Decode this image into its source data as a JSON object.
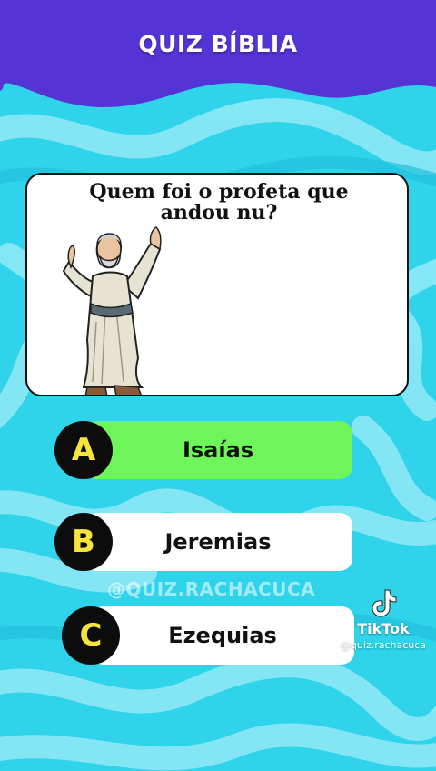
{
  "header": {
    "title": "QUIZ BÍBLIA"
  },
  "question": {
    "text": "Quem foi o profeta que andou nu?"
  },
  "answers": [
    {
      "letter": "A",
      "text": "Isaías"
    },
    {
      "letter": "B",
      "text": "Jeremias"
    },
    {
      "letter": "C",
      "text": "Ezequias"
    }
  ],
  "watermark": {
    "text": "@QUIZ.RACHACUCA"
  },
  "tiktok": {
    "icon": "tiktok-note-icon",
    "name": "TikTok",
    "handle": "@quiz.rachacuca"
  },
  "colors": {
    "header": "#5434d4",
    "background": "#2fd3ea",
    "swirl": "#8ee9f7",
    "highlight_answer": "#6ef55a",
    "answer": "#ffffff",
    "letter_color": "#f6e43a",
    "badge": "#0c0c0c"
  }
}
